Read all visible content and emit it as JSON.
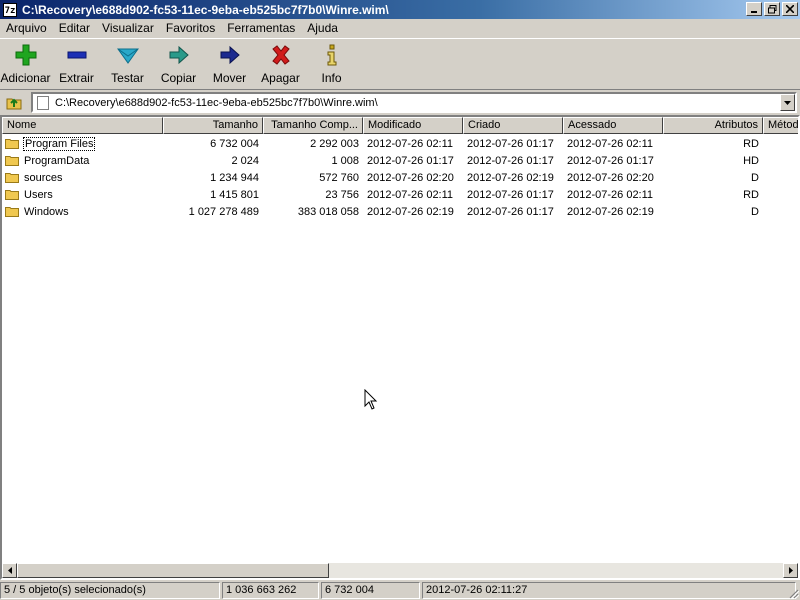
{
  "window": {
    "icon_text": "7z",
    "title": "C:\\Recovery\\e688d902-fc53-11ec-9eba-eb525bc7f7b0\\Winre.wim\\"
  },
  "menu": [
    "Arquivo",
    "Editar",
    "Visualizar",
    "Favoritos",
    "Ferramentas",
    "Ajuda"
  ],
  "toolbar": [
    {
      "label": "Adicionar",
      "icon": "plus-icon",
      "color": "#1fa51f"
    },
    {
      "label": "Extrair",
      "icon": "minus-icon",
      "color": "#1c2fb5"
    },
    {
      "label": "Testar",
      "icon": "check-icon",
      "color": "#2aa8c9"
    },
    {
      "label": "Copiar",
      "icon": "copy-arrow-icon",
      "color": "#2a9a8a"
    },
    {
      "label": "Mover",
      "icon": "move-arrow-icon",
      "color": "#1c2a8f"
    },
    {
      "label": "Apagar",
      "icon": "delete-x-icon",
      "color": "#d11b1b"
    },
    {
      "label": "Info",
      "icon": "info-icon",
      "color": "#c9a81c"
    }
  ],
  "address": {
    "path": "C:\\Recovery\\e688d902-fc53-11ec-9eba-eb525bc7f7b0\\Winre.wim\\"
  },
  "columns": [
    "Nome",
    "Tamanho",
    "Tamanho Comp...",
    "Modificado",
    "Criado",
    "Acessado",
    "Atributos",
    "Métod"
  ],
  "files": [
    {
      "name": "Program Files",
      "size": "6 732 004",
      "packed": "2 292 003",
      "modified": "2012-07-26 02:11",
      "created": "2012-07-26 01:17",
      "accessed": "2012-07-26 02:11",
      "attrs": "RD"
    },
    {
      "name": "ProgramData",
      "size": "2 024",
      "packed": "1 008",
      "modified": "2012-07-26 01:17",
      "created": "2012-07-26 01:17",
      "accessed": "2012-07-26 01:17",
      "attrs": "HD"
    },
    {
      "name": "sources",
      "size": "1 234 944",
      "packed": "572 760",
      "modified": "2012-07-26 02:20",
      "created": "2012-07-26 02:19",
      "accessed": "2012-07-26 02:20",
      "attrs": "D"
    },
    {
      "name": "Users",
      "size": "1 415 801",
      "packed": "23 756",
      "modified": "2012-07-26 02:11",
      "created": "2012-07-26 01:17",
      "accessed": "2012-07-26 02:11",
      "attrs": "RD"
    },
    {
      "name": "Windows",
      "size": "1 027 278 489",
      "packed": "383 018 058",
      "modified": "2012-07-26 02:19",
      "created": "2012-07-26 01:17",
      "accessed": "2012-07-26 02:19",
      "attrs": "D"
    }
  ],
  "status": {
    "selection": "5 / 5 objeto(s) selecionado(s)",
    "total_size": "1 036 663 262",
    "selected_size": "6 732 004",
    "modified": "2012-07-26 02:11:27"
  }
}
